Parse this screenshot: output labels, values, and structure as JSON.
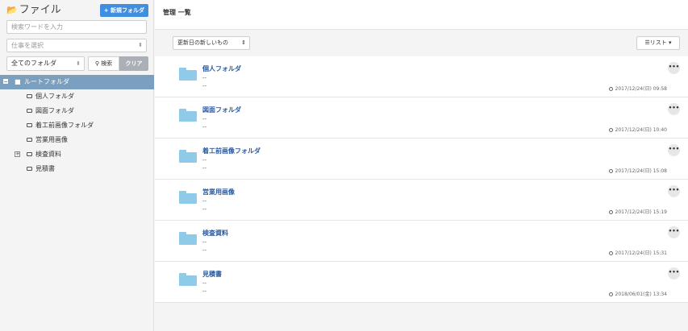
{
  "sidebar": {
    "title": "ファイル",
    "new_folder_button": "+ 新規フォルダ",
    "search_placeholder": "検索ワードを入力",
    "job_select_placeholder": "仕事を選択",
    "folder_filter": "全てのフォルダ",
    "search_button": "検索",
    "clear_button": "クリア",
    "tree": {
      "root": "ルートフォルダ",
      "items": [
        {
          "label": "個人フォルダ",
          "expandable": false
        },
        {
          "label": "図面フォルダ",
          "expandable": false
        },
        {
          "label": "着工前画像フォルダ",
          "expandable": false
        },
        {
          "label": "営業用画像",
          "expandable": false
        },
        {
          "label": "検査資料",
          "expandable": true
        },
        {
          "label": "見積書",
          "expandable": false
        }
      ]
    }
  },
  "main": {
    "page_title": "管理 一覧",
    "sort_select": "更新日の新しいもの",
    "view_button": "リスト",
    "folders": [
      {
        "name": "個人フォルダ",
        "line1": "--",
        "line2": "--",
        "date": "2017/12/24(日) 09:58"
      },
      {
        "name": "図面フォルダ",
        "line1": "--",
        "line2": "--",
        "date": "2017/12/24(日) 10:40"
      },
      {
        "name": "着工前画像フォルダ",
        "line1": "--",
        "line2": "--",
        "date": "2017/12/24(日) 15:08"
      },
      {
        "name": "営業用画像",
        "line1": "--",
        "line2": "--",
        "date": "2017/12/24(日) 15:19"
      },
      {
        "name": "検査資料",
        "line1": "--",
        "line2": "--",
        "date": "2017/12/24(日) 15:31"
      },
      {
        "name": "見積書",
        "line1": "--",
        "line2": "--",
        "date": "2018/06/01(金) 13:34"
      }
    ]
  },
  "colors": {
    "accent": "#3f8ee0",
    "tree_selected": "#7b9fbe",
    "folder_icon": "#8fcbe9",
    "link": "#2a5aa0"
  }
}
